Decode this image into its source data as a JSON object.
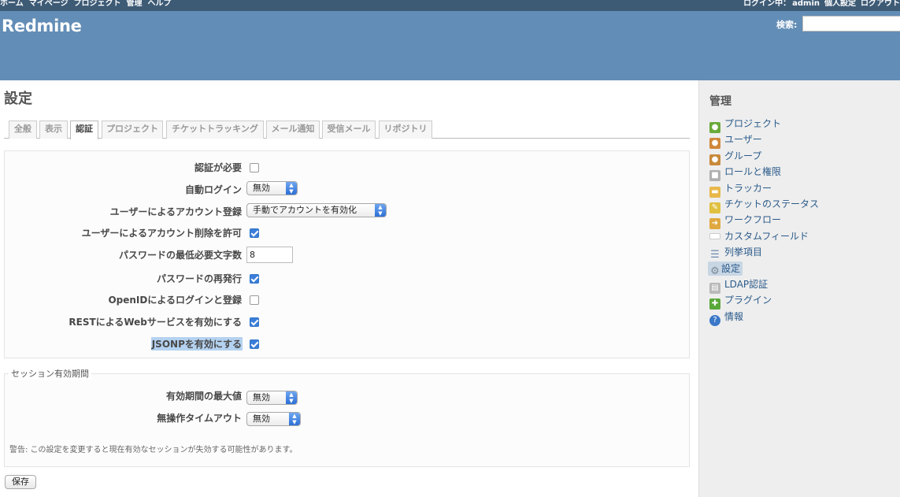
{
  "top_menu": {
    "left": [
      "ホーム",
      "マイページ",
      "プロジェクト",
      "管理",
      "ヘルプ"
    ],
    "logged_in_label": "ログイン中：",
    "user": "admin",
    "account": "個人設定",
    "logout": "ログアウト"
  },
  "header": {
    "app_title": "Redmine",
    "search_label": "検索:",
    "search_value": ""
  },
  "page": {
    "title": "設定",
    "tabs": [
      "全般",
      "表示",
      "認証",
      "プロジェクト",
      "チケットトラッキング",
      "メール通知",
      "受信メール",
      "リポジトリ"
    ],
    "selected_tab": "認証"
  },
  "auth": {
    "login_required": {
      "label": "認証が必要",
      "checked": false
    },
    "autologin": {
      "label": "自動ログイン",
      "value": "無効"
    },
    "self_registration": {
      "label": "ユーザーによるアカウント登録",
      "value": "手動でアカウントを有効化"
    },
    "unsubscribe": {
      "label": "ユーザーによるアカウント削除を許可",
      "checked": true
    },
    "password_min_length": {
      "label": "パスワードの最低必要文字数",
      "value": "8"
    },
    "lost_password": {
      "label": "パスワードの再発行",
      "checked": true
    },
    "openid": {
      "label": "OpenIDによるログインと登録",
      "checked": false
    },
    "rest_api": {
      "label": "RESTによるWebサービスを有効にする",
      "checked": true
    },
    "jsonp": {
      "label": "JSONPを有効にする",
      "checked": true
    }
  },
  "session": {
    "legend": "セッション有効期間",
    "lifetime": {
      "label": "有効期間の最大値",
      "value": "無効"
    },
    "timeout": {
      "label": "無操作タイムアウト",
      "value": "無効"
    },
    "warning": "警告: この設定を変更すると現在有効なセッションが失効する可能性があります。"
  },
  "save_label": "保存",
  "sidebar": {
    "title": "管理",
    "items": [
      {
        "label": "プロジェクト",
        "icon": "projects-icon",
        "color": "#6aaa3a"
      },
      {
        "label": "ユーザー",
        "icon": "user-icon",
        "color": "#d0883a"
      },
      {
        "label": "グループ",
        "icon": "group-icon",
        "color": "#c88a3a"
      },
      {
        "label": "ロールと権限",
        "icon": "lock-icon",
        "color": "#b0b0b0"
      },
      {
        "label": "トラッカー",
        "icon": "ticket-icon",
        "color": "#e8b84a"
      },
      {
        "label": "チケットのステータス",
        "icon": "ticket-edit-icon",
        "color": "#e0c040"
      },
      {
        "label": "ワークフロー",
        "icon": "workflow-icon",
        "color": "#e0a840"
      },
      {
        "label": "カスタムフィールド",
        "icon": "textfield-icon",
        "color": "#ffffff"
      },
      {
        "label": "列挙項目",
        "icon": "list-icon",
        "color": "#6a8ab0"
      },
      {
        "label": "設定",
        "icon": "gear-icon",
        "color": "#9aa8b8",
        "selected": true
      },
      {
        "label": "LDAP認証",
        "icon": "server-key-icon",
        "color": "#b8b8b8"
      },
      {
        "label": "プラグイン",
        "icon": "plugin-icon",
        "color": "#5aa83a"
      },
      {
        "label": "情報",
        "icon": "help-icon",
        "color": "#3a78c8"
      }
    ]
  }
}
